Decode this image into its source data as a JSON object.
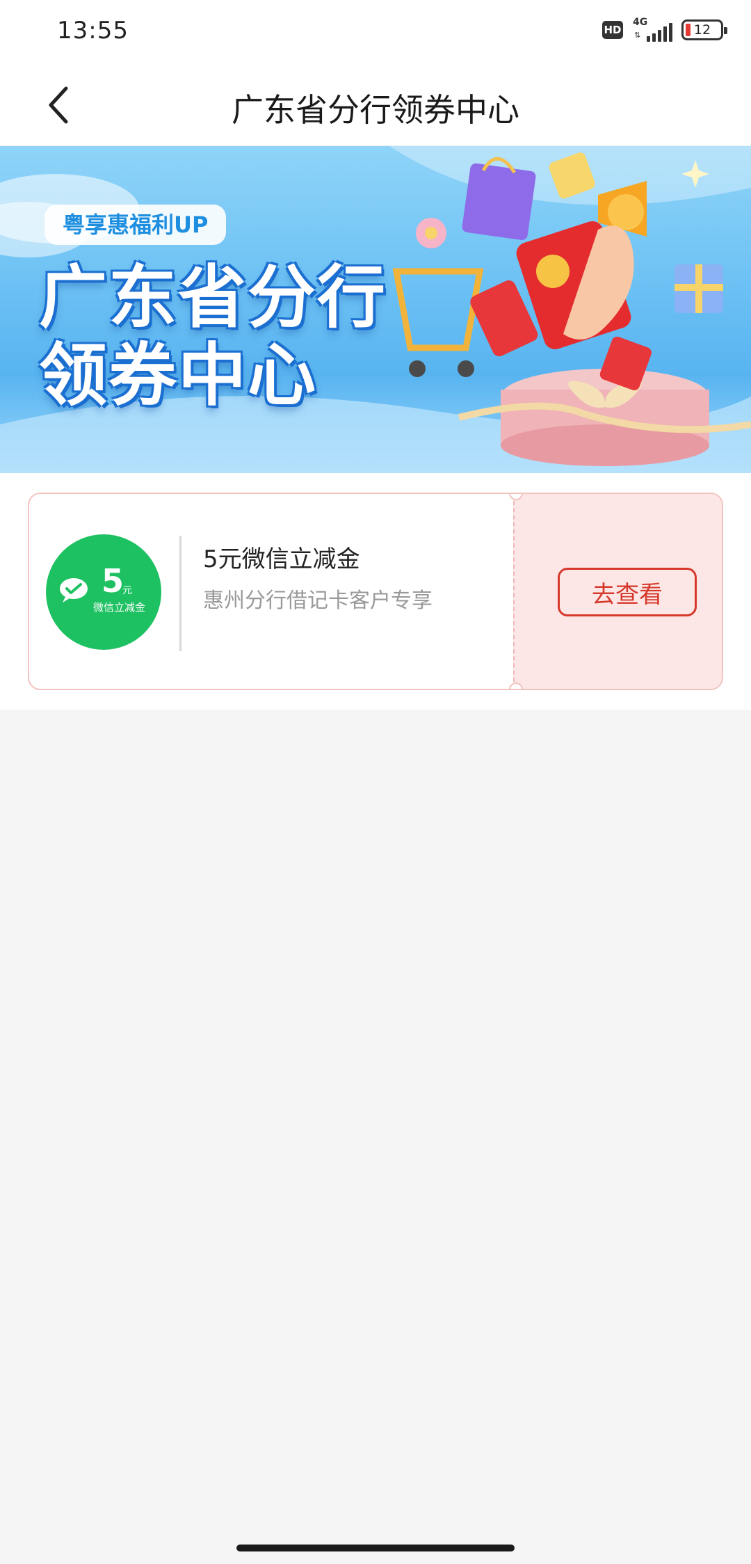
{
  "status_bar": {
    "time": "13:55",
    "hd": "HD",
    "network": "4G",
    "battery": "12"
  },
  "nav": {
    "title": "广东省分行领券中心"
  },
  "banner": {
    "tag": "粤享惠福利UP",
    "headline_line1": "广东省分行",
    "headline_line2": "领券中心"
  },
  "coupons": [
    {
      "logo_amount": "5",
      "logo_unit": "元",
      "logo_caption": "微信立减金",
      "title": "5元微信立减金",
      "description": "惠州分行借记卡客户专享",
      "action_label": "去查看"
    }
  ]
}
